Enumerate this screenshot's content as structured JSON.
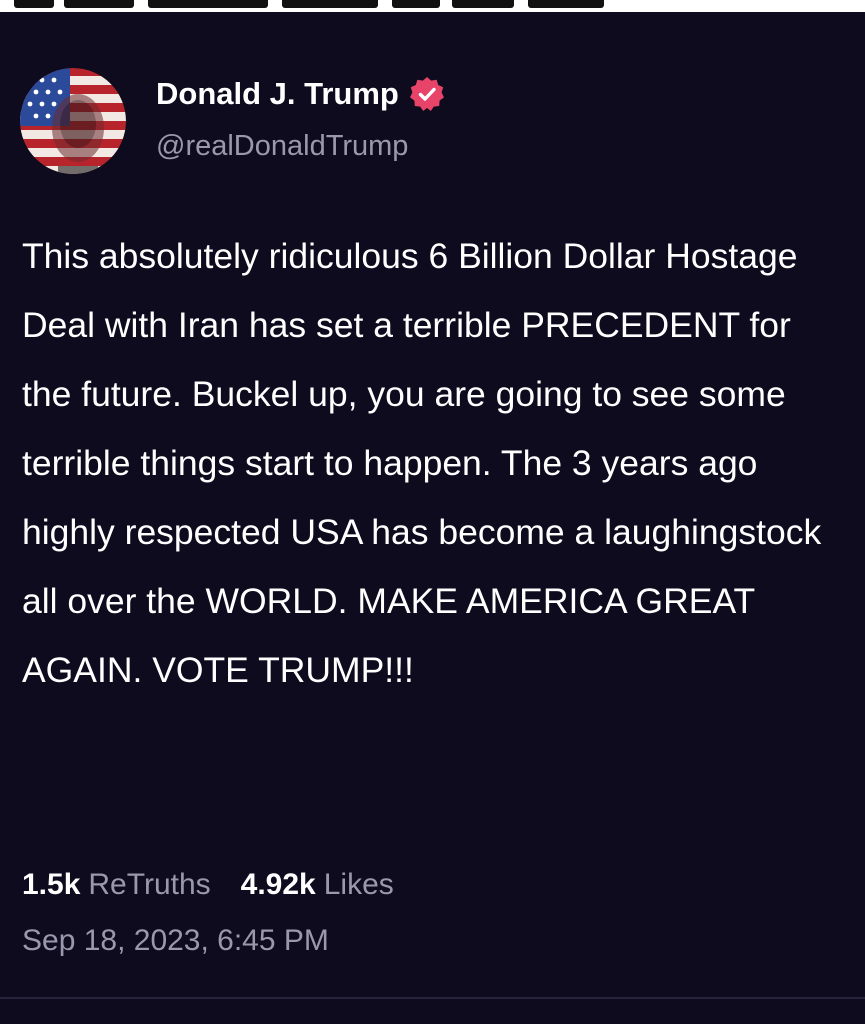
{
  "post": {
    "author": {
      "name": "Donald J. Trump",
      "handle": "@realDonaldTrump",
      "verified": true,
      "avatar_icon": "flag-portrait-avatar",
      "verified_icon": "verified-badge-icon",
      "verified_color": "#e8446a"
    },
    "body": "This absolutely ridiculous 6 Billion Dollar Hostage Deal with Iran has set a terrible PRECEDENT for the future. Buckel up, you are going to see some terrible things start to happen. The 3 years ago highly respected USA has become a laughingstock all over the WORLD. MAKE AMERICA GREAT AGAIN. VOTE TRUMP!!!",
    "stats": {
      "retruths_count": "1.5k",
      "retruths_label": "ReTruths",
      "likes_count": "4.92k",
      "likes_label": "Likes"
    },
    "timestamp": "Sep 18, 2023, 6:45 PM"
  },
  "colors": {
    "background": "#0d0b1d",
    "primary_text": "#ffffff",
    "secondary_text": "#9b98ad",
    "accent": "#e8446a"
  }
}
